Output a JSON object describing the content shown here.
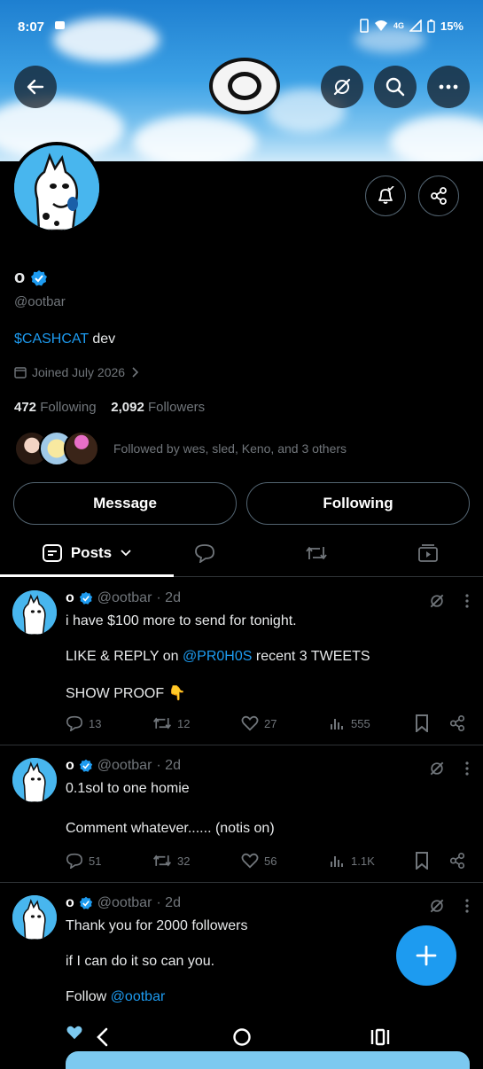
{
  "status_bar": {
    "time": "8:07",
    "network": "4G",
    "battery": "15%"
  },
  "profile": {
    "name": "o",
    "handle": "@ootbar",
    "bio_link": "$CASHCAT",
    "bio_rest": " dev",
    "joined": "Joined July 2026",
    "following_count": "472",
    "following_label": "Following",
    "followers_count": "2,092",
    "followers_label": "Followers",
    "followed_by": "Followed by wes, sled, Keno, and 3 others",
    "message_button": "Message",
    "following_button": "Following"
  },
  "tabs": {
    "posts": "Posts"
  },
  "posts": [
    {
      "name": "o",
      "handle": "@ootbar",
      "time": "· 2d",
      "line1": "i have $100 more to send for tonight.",
      "line2_pre": "LIKE & REPLY on ",
      "line2_mention": "@PR0H0S",
      "line2_post": " recent 3 TWEETS",
      "line3": "SHOW PROOF 👇",
      "replies": "13",
      "reposts": "12",
      "likes": "27",
      "views": "555"
    },
    {
      "name": "o",
      "handle": "@ootbar",
      "time": "· 2d",
      "line1": "0.1sol to one homie",
      "line2": "Comment whatever...... (notis on)",
      "replies": "51",
      "reposts": "32",
      "likes": "56",
      "views": "1.1K"
    },
    {
      "name": "o",
      "handle": "@ootbar",
      "time": "· 2d",
      "line1": "Thank you for 2000 followers",
      "line2": "if I can do it so can you.",
      "line3_pre": "Follow ",
      "line3_mention": "@ootbar"
    }
  ],
  "colors": {
    "accent": "#1d9bf0",
    "muted": "#71767b",
    "background": "#000000"
  }
}
